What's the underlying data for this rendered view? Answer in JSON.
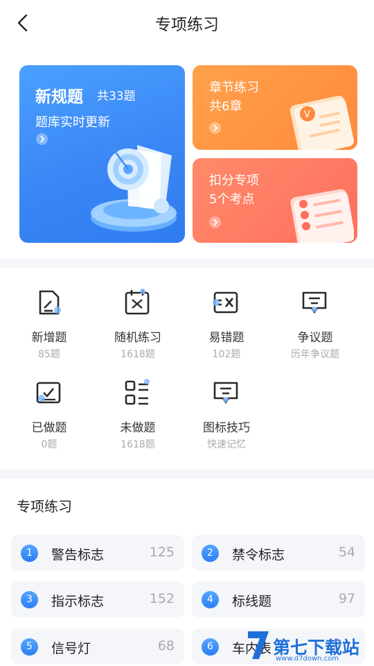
{
  "header": {
    "title": "专项练习"
  },
  "hero": {
    "new_rules": {
      "title": "新规题",
      "count": "共33题",
      "subtitle": "题库实时更新"
    },
    "chapter": {
      "title": "章节练习",
      "sub": "共6章"
    },
    "deduct": {
      "title": "扣分专项",
      "sub": "5个考点"
    }
  },
  "grid": [
    {
      "label": "新增题",
      "sub": "85题",
      "icon": "doc-edit-icon"
    },
    {
      "label": "随机练习",
      "sub": "1618题",
      "icon": "shuffle-calendar-icon"
    },
    {
      "label": "易错题",
      "sub": "102题",
      "icon": "error-x-icon"
    },
    {
      "label": "争议题",
      "sub": "历年争议题",
      "icon": "comment-icon"
    },
    {
      "label": "已做题",
      "sub": "0题",
      "icon": "check-board-icon"
    },
    {
      "label": "未做题",
      "sub": "1618题",
      "icon": "list-icon"
    },
    {
      "label": "图标技巧",
      "sub": "快速记忆",
      "icon": "message-icon"
    }
  ],
  "special": {
    "title": "专项练习",
    "items": [
      {
        "num": "1",
        "label": "警告标志",
        "count": "125"
      },
      {
        "num": "2",
        "label": "禁令标志",
        "count": "54"
      },
      {
        "num": "3",
        "label": "指示标志",
        "count": "152"
      },
      {
        "num": "4",
        "label": "标线题",
        "count": "97"
      },
      {
        "num": "5",
        "label": "信号灯",
        "count": "68"
      },
      {
        "num": "6",
        "label": "车内表",
        "count": ""
      }
    ]
  },
  "watermark": {
    "title": "第七下载站",
    "url": "www.d7down.com"
  }
}
